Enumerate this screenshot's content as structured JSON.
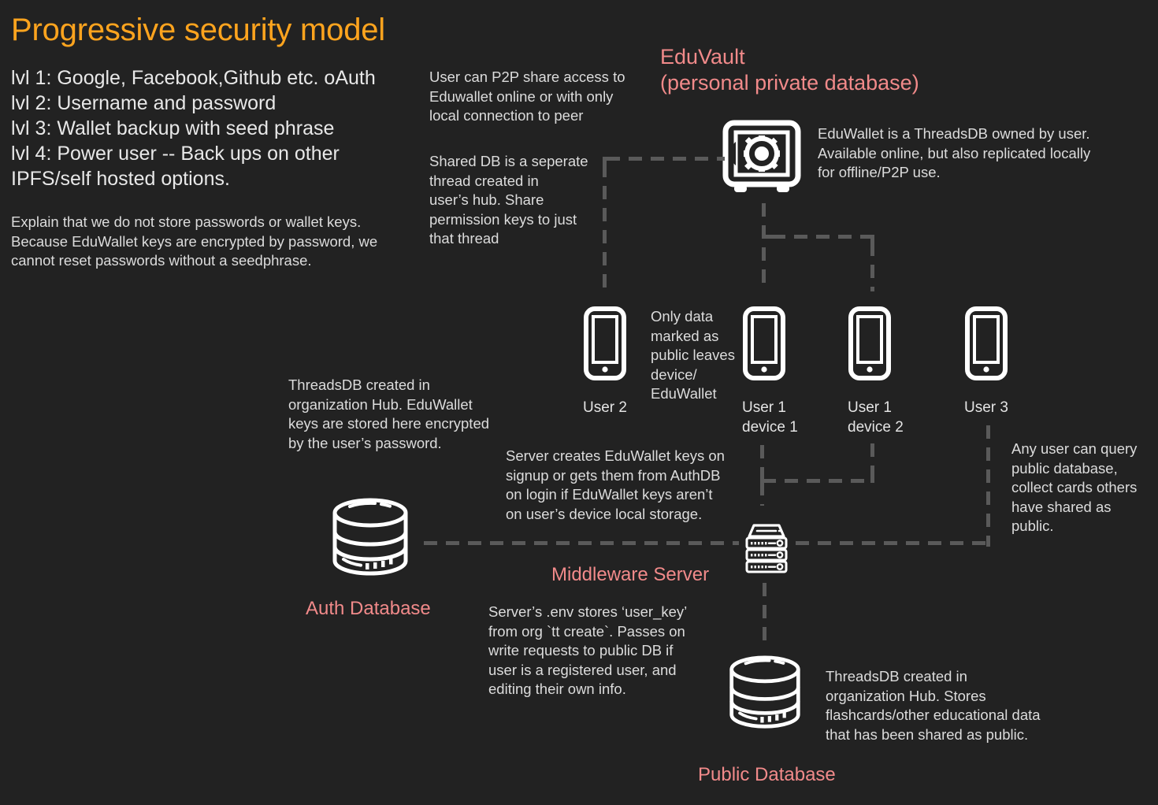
{
  "title": "Progressive security model",
  "levels": "lvl 1: Google, Facebook,Github etc. oAuth\nlvl 2: Username and password\nlvl 3: Wallet backup with seed phrase\nlvl 4: Power user -- Back ups on other\nIPFS/self hosted options.",
  "password_note": "Explain that we do not store passwords or wallet keys.\nBecause EduWallet keys are encrypted by password, we\ncannot reset passwords without a seedphrase.",
  "p2p_note": "User can P2P share access to\nEduwallet online or with only\nlocal connection to peer",
  "shared_db_note": "Shared DB is a seperate\nthread created in\nuser’s hub. Share\npermission keys to just\nthat thread",
  "eduvault": {
    "label": "EduVault\n(personal private database)",
    "icon": "safe-vault-icon",
    "description": "EduWallet is a ThreadsDB owned by user.\nAvailable online, but also replicated locally\nfor offline/P2P use."
  },
  "devices": [
    {
      "icon": "mobile-phone-icon",
      "label": "User 2"
    },
    {
      "icon": "mobile-phone-icon",
      "label": "User 1\ndevice 1"
    },
    {
      "icon": "mobile-phone-icon",
      "label": "User 1\ndevice 2"
    },
    {
      "icon": "mobile-phone-icon",
      "label": "User 3"
    }
  ],
  "public_leaves_note": "Only data\nmarked as\npublic leaves\ndevice/\nEduWallet",
  "auth_db": {
    "icon": "database-cylinder-icon",
    "label": "Auth Database",
    "description": "ThreadsDB created in\norganization Hub. EduWallet\nkeys are stored here encrypted\nby the user’s password."
  },
  "middleware": {
    "icon": "server-rack-icon",
    "label": "Middleware Server",
    "note_top": "Server creates EduWallet keys on\nsignup or gets them from AuthDB\non login if EduWallet keys aren’t\non user’s device local storage.",
    "note_bottom": "Server’s .env stores ‘user_key’\nfrom org `tt create`. Passes on\nwrite requests to public DB if\nuser is a registered user, and\nediting their own info."
  },
  "public_db": {
    "icon": "database-cylinder-icon",
    "label": "Public Database",
    "description": "ThreadsDB created in\norganization Hub. Stores\nflashcards/other educational data\nthat has been shared as public."
  },
  "query_note": "Any user can query\npublic database,\ncollect cards others\nhave shared as\npublic.",
  "colors": {
    "background": "#222222",
    "title_orange": "#FFA41E",
    "label_pink": "#F18A8A",
    "body_text": "#DCDCDC",
    "icon_white": "#FFFFFF",
    "connector_gray": "#5A5A5A"
  }
}
